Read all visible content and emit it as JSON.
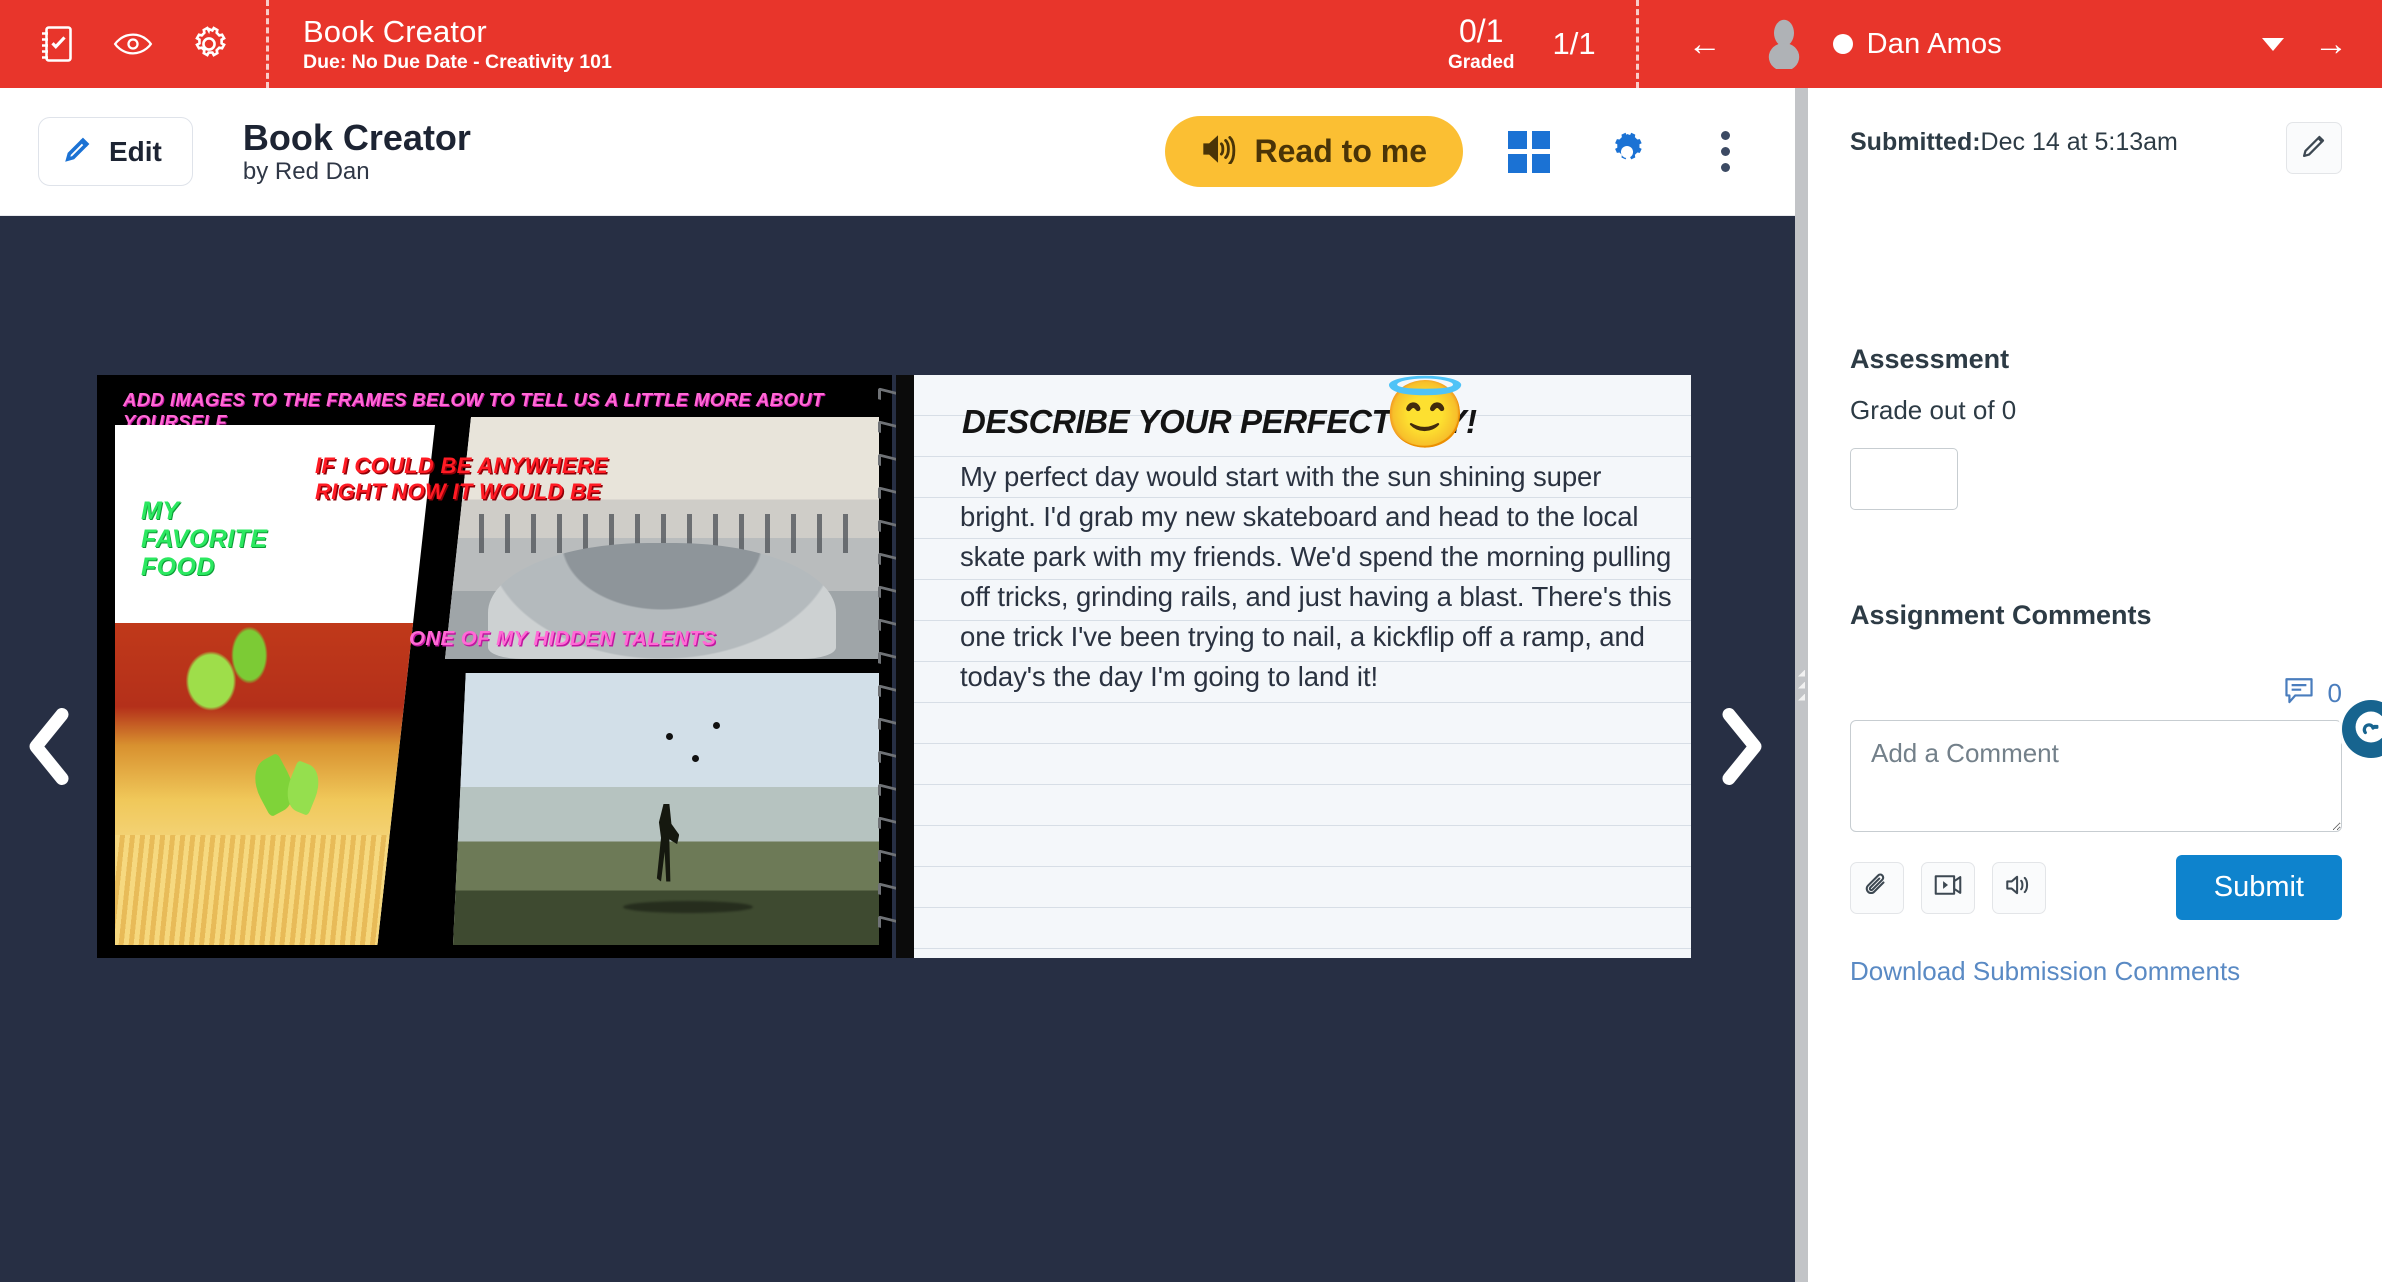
{
  "topbar": {
    "icons": [
      {
        "name": "assignment-icon",
        "label": "Assignment"
      },
      {
        "name": "eye-icon",
        "label": "Preview"
      },
      {
        "name": "gear-icon",
        "label": "Settings"
      }
    ],
    "title": "Book Creator",
    "subtitle": "Due: No Due Date - Creativity 101",
    "score": "0/1",
    "score_label": "Graded",
    "page_count": "1/1",
    "prev_arrow": "←",
    "next_arrow": "→",
    "student_name": "Dan Amos",
    "status_dot_color": "#ffffff",
    "bg_color": "#E8352B"
  },
  "viewer_toolbar": {
    "edit_label": "Edit",
    "book_title": "Book Creator",
    "book_author": "by Red Dan",
    "read_label": "Read to me",
    "read_bg_color": "#FBBF33",
    "grid_icon": "grid-view-icon",
    "gear_icon": "gear-icon",
    "kebab_icon": "more-options-icon"
  },
  "stage": {
    "bg_color": "#272F44",
    "prev_page": "‹",
    "next_page": "›"
  },
  "book": {
    "left_page": {
      "header": "ADD IMAGES TO THE FRAMES BELOW TO TELL US A LITTLE MORE ABOUT YOURSELF",
      "header_color": "#FF6AD5",
      "frames": [
        {
          "label": "MY\nFAVORITE\nFOOD",
          "color": "#2BE860",
          "name": "favorite-food-frame"
        },
        {
          "label": "IF I COULD BE ANYWHERE\nRIGHT NOW IT WOULD BE",
          "color": "#FF1B24",
          "name": "anywhere-frame"
        },
        {
          "label": "ONE OF MY HIDDEN TALENTS",
          "color": "#FF6AD5",
          "name": "hidden-talents-frame"
        }
      ]
    },
    "right_page": {
      "title": "DESCRIBE YOUR PERFECT DAY!",
      "emoji": "😇",
      "body": "My perfect day would start with the sun shining super bright. I'd grab my new skateboard and head to the local skate park with my friends. We'd spend the morning pulling off tricks, grinding rails, and just having a blast. There's this one trick I've been trying to nail, a kickflip off a ramp, and today's the day I'm going to land it!"
    }
  },
  "sidebar": {
    "submitted_label": "Submitted:",
    "submitted_value": "Dec 14 at 5:13am",
    "edit_submission_icon": "pencil-icon",
    "assessment_heading": "Assessment",
    "grade_label": "Grade out of 0",
    "grade_value": "",
    "comments_heading": "Assignment Comments",
    "comment_count": "0",
    "comment_placeholder": "Add a Comment",
    "comment_value": "",
    "tools": [
      {
        "name": "attach-file-button",
        "icon": "paperclip-icon"
      },
      {
        "name": "record-video-button",
        "icon": "video-icon"
      },
      {
        "name": "record-audio-button",
        "icon": "speaker-icon"
      }
    ],
    "submit_label": "Submit",
    "submit_color": "#0E83CD",
    "download_link": "Download Submission Comments",
    "chat_icon": "chat-support-icon"
  }
}
